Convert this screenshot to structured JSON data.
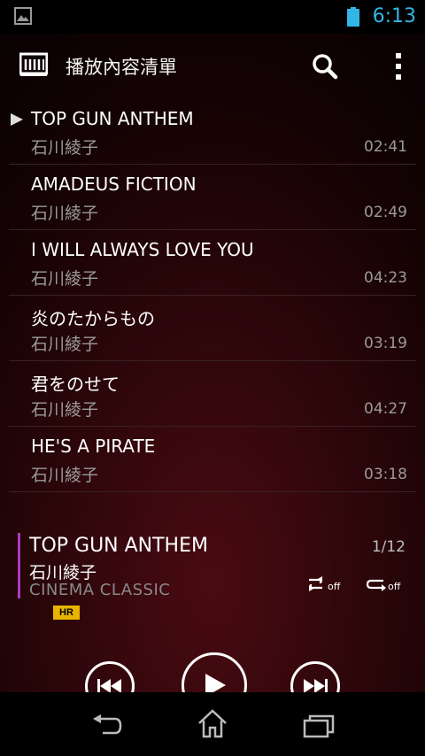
{
  "status_bar": {
    "time": "6:13",
    "icons": [
      "image-notification-icon",
      "battery-icon"
    ]
  },
  "header": {
    "title": "播放內容清單"
  },
  "tracks": [
    {
      "title": "TOP GUN ANTHEM",
      "artist": "石川綾子",
      "duration": "02:41",
      "playing": true
    },
    {
      "title": "AMADEUS FICTION",
      "artist": "石川綾子",
      "duration": "02:49"
    },
    {
      "title": "I WILL ALWAYS LOVE YOU",
      "artist": "石川綾子",
      "duration": "04:23"
    },
    {
      "title": "炎のたからもの",
      "artist": "石川綾子",
      "duration": "03:19"
    },
    {
      "title": "君をのせて",
      "artist": "石川綾子",
      "duration": "04:27"
    },
    {
      "title": "HE'S A PIRATE",
      "artist": "石川綾子",
      "duration": "03:18"
    }
  ],
  "now_playing": {
    "title": "TOP GUN ANTHEM",
    "artist": "石川綾子",
    "album": "CINEMA CLASSIC",
    "position": "1/12",
    "badge": "HR",
    "shuffle_label": "off",
    "repeat_label": "off"
  },
  "colors": {
    "accent": "#33b5e5",
    "now_bar": "#b03ac0",
    "badge": "#e8b400"
  }
}
